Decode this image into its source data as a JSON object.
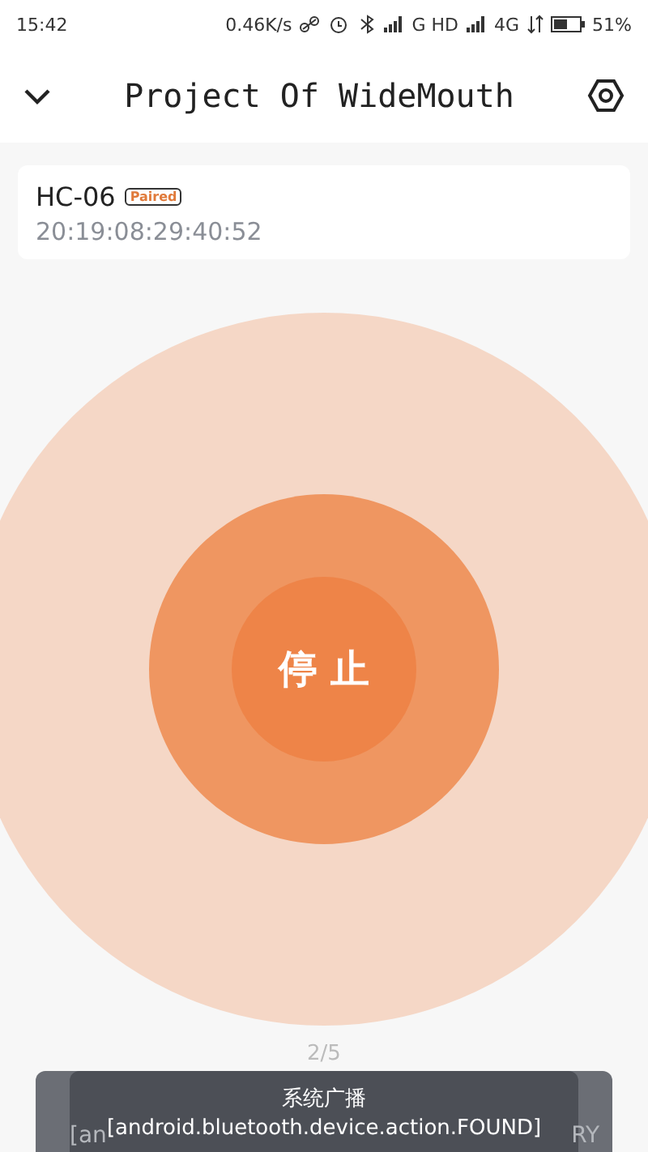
{
  "status_bar": {
    "time": "15:42",
    "speed": "0.46K/s",
    "network_1": "G HD",
    "network_2": "4G",
    "battery": "51%"
  },
  "header": {
    "title": "Project Of WideMouth"
  },
  "device": {
    "name": "HC-06",
    "badge": "Paired",
    "address": "20:19:08:29:40:52"
  },
  "scan_button": {
    "label": "停 止"
  },
  "pager": "2/5",
  "toasts": [
    {
      "kind": "front",
      "texts": [
        "系统广播",
        "[android.bluetooth.device.action.FOUND]"
      ]
    },
    {
      "kind": "back",
      "texts": [
        "[an",
        "RY"
      ]
    }
  ]
}
